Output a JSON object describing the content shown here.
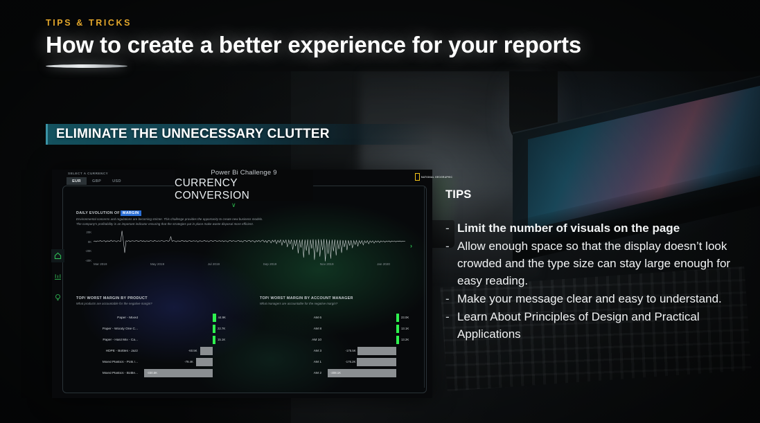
{
  "slide": {
    "kicker": "TIPS & TRICKS",
    "headline": "How to create a better experience for your reports",
    "banner": "ELIMINATE THE UNNECESSARY CLUTTER"
  },
  "tips": {
    "heading": "TIPS",
    "bullet_marker": "-",
    "items": [
      {
        "text": "Limit the number of visuals on the page",
        "bold": true
      },
      {
        "text": "Allow enough space so that the display doesn’t look crowded and the type size can stay large enough for easy reading.",
        "bold": false
      },
      {
        "text": "Make your message clear and easy to understand.",
        "bold": false
      },
      {
        "text": "Learn About Principles of Design and Practical Applications",
        "bold": false
      }
    ]
  },
  "dashboard": {
    "currency_selector": {
      "label": "SELECT A CURRENCY",
      "options": [
        "EUR",
        "GBP",
        "USD"
      ],
      "selected": "EUR"
    },
    "subtitle": "Power Bi Challenge 9",
    "title": "CURRENCY CONVERSION",
    "chevron": "∨",
    "next_arrow": "›",
    "logo_word": "NATIONAL GEOGRAPHIC",
    "rail_icons": [
      "home-icon",
      "bar-chart-icon",
      "lightbulb-icon"
    ],
    "line_chart_header": {
      "title_prefix": "DAILY EVOLUTION OF",
      "title_highlight": "MARGIN",
      "desc_line_1": "Environmental concerns and regulations are becoming stricter. This challenge provides the opportunity to create new business models.",
      "desc_line_2": "The company's profitability is an important indicator ensuring that the strategies put in place make waste disposal more efficient."
    }
  },
  "chart_data": [
    {
      "type": "line",
      "title": "DAILY EVOLUTION OF MARGIN",
      "xlabel": "",
      "ylabel": "",
      "ylim": [
        -40000,
        20000
      ],
      "ytick_labels": [
        "20K",
        "0K",
        "-20K",
        "-40K"
      ],
      "ytick_values": [
        20000,
        0,
        -20000,
        -40000
      ],
      "xtick_labels": [
        "Mar 2019",
        "May 2019",
        "Jul 2019",
        "Sep 2019",
        "Nov 2019",
        "Jan 2020"
      ],
      "grid": false,
      "series_color": "#d8dcde",
      "values": [
        -300,
        400,
        -900,
        600,
        -200,
        1100,
        -700,
        300,
        900,
        -1200,
        500,
        200,
        -400,
        1800,
        -600,
        700,
        400,
        -1100,
        900,
        300,
        -500,
        19500,
        600,
        -22000,
        800,
        -300,
        1200,
        -900,
        400,
        700,
        -200,
        500,
        900,
        -600,
        300,
        1000,
        -400,
        800,
        -1000,
        600,
        200,
        -300,
        900,
        400,
        -700,
        1100,
        300,
        -500,
        700,
        -200,
        900,
        600,
        -800,
        400,
        1200,
        -300,
        700,
        8500,
        -400,
        900,
        300,
        -1100,
        600,
        200,
        -700,
        1000,
        500,
        -300,
        800,
        -900,
        400,
        1100,
        -600,
        300,
        700,
        -200,
        900,
        -1400,
        500,
        600,
        -800,
        400,
        1000,
        -300,
        700,
        -1100,
        500,
        900,
        -400,
        600,
        1200,
        -700,
        300,
        800,
        -500,
        1000,
        -900,
        600,
        400,
        -1300,
        700,
        1100,
        -600,
        900,
        300,
        -800,
        500,
        1400,
        -700,
        600,
        -1600,
        900,
        1200,
        -900,
        700,
        1500,
        -1200,
        800,
        400,
        -2100,
        1100,
        -700,
        1600,
        -1400,
        900,
        2000,
        -1800,
        1200,
        -2600,
        1500,
        800,
        -3400,
        1800,
        -1500,
        2200,
        -4800,
        1600,
        -2400,
        2600,
        -7600,
        1900,
        -3200,
        2400,
        -11000,
        2100,
        -5400,
        2800,
        -16000,
        2300,
        -9200,
        3000,
        -23000,
        2500,
        -12000,
        3200,
        -31000,
        2700,
        -18000,
        3400,
        -26000,
        2900,
        -14000,
        3600,
        -35000,
        3100,
        -21000,
        3800,
        -29000,
        3300,
        -17000,
        4000,
        -38000,
        3500,
        -24000,
        2600,
        -33000,
        2800,
        -19000,
        3000,
        -27000,
        2200,
        -15000,
        2400,
        -22000,
        1800,
        -11000,
        2000,
        -17000,
        1500,
        -8500,
        1700,
        -13000,
        1200,
        -6200,
        1400,
        -9800,
        1000,
        -4500,
        1100,
        -7200,
        800,
        -3300,
        900,
        -5100,
        600,
        -2400,
        700,
        -3800,
        500,
        -1800,
        600,
        -2700,
        400,
        -1300,
        500,
        -2000,
        350,
        -1000,
        450,
        -1500,
        300,
        -800,
        400,
        -1200,
        250,
        -600,
        350,
        -950,
        200,
        -500,
        300
      ]
    },
    {
      "type": "bar",
      "orientation": "horizontal",
      "title": "TOP/ WORST MARGIN BY PRODUCT",
      "subtitle": "What products are accountable for the negative margin?",
      "categories": [
        "Paper - Mixed",
        "Paper - Woody One C...",
        "Paper - Hard Mix - Ca...",
        "HDPE - Bottles - Jazz",
        "Mixed Plastics - Pots /...",
        "Mixed Plastics - Bottle..."
      ],
      "values": [
        44900,
        22700,
        15100,
        -60500,
        -79400,
        -330500
      ],
      "value_labels": [
        "44.9K",
        "22.7K",
        "15.1K",
        "-60.5K",
        "-79.4K",
        "-330.5K"
      ],
      "positive_color": "#2ef24f",
      "negative_color": "#8b8f92"
    },
    {
      "type": "bar",
      "orientation": "horizontal",
      "title": "TOP/ WORST MARGIN BY ACCOUNT MANAGER",
      "subtitle": "What managers are accountable for the negative margin?",
      "categories": [
        "AM 6",
        "AM 8",
        "AM 10",
        "AM 3",
        "AM 1",
        "AM 2"
      ],
      "values": [
        23000,
        13100,
        13200,
        -175500,
        -176200,
        -308100
      ],
      "value_labels": [
        "23.0K",
        "13.1K",
        "13.2K",
        "-175.5K",
        "-176.2K",
        "-308.1K"
      ],
      "positive_color": "#2ef24f",
      "negative_color": "#8b8f92"
    }
  ],
  "colors": {
    "accent_gold": "#e3a72b",
    "banner_teal": "#14525f",
    "highlight_blue": "#2b6fd6",
    "green": "#2ef24f",
    "gray_bar": "#8b8f92"
  }
}
